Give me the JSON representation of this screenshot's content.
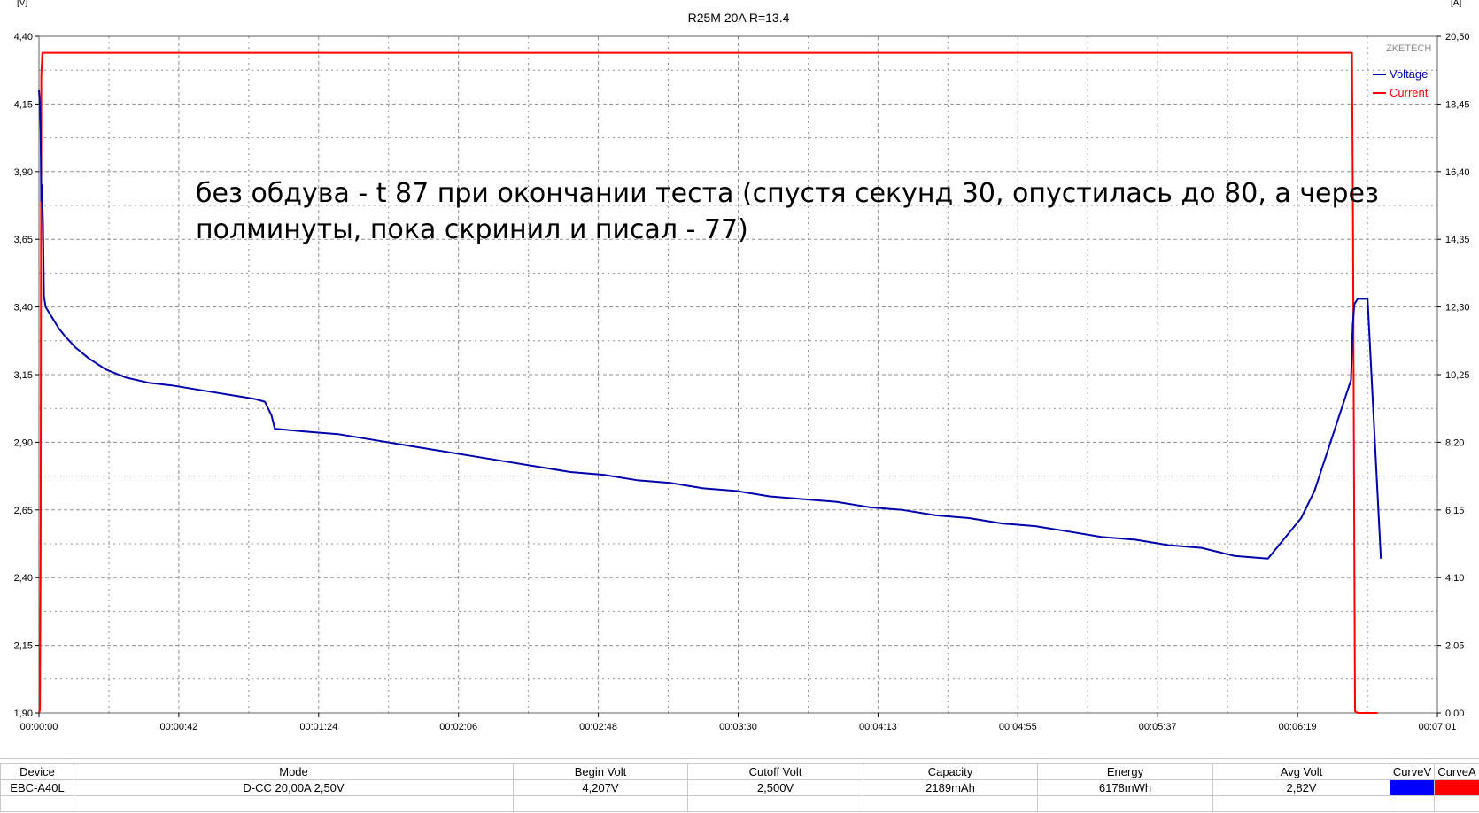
{
  "chart_data": {
    "type": "line",
    "title": "R25M 20A R=13.4",
    "y_left_unit": "[V]",
    "y_right_unit": "[A]",
    "ylim_left": [
      1.9,
      4.4
    ],
    "ylim_right": [
      0,
      20.5
    ],
    "y_left_ticks": [
      "4,40",
      "4,15",
      "3,90",
      "3,65",
      "3,40",
      "3,15",
      "2,90",
      "2,65",
      "2,40",
      "2,15",
      "1,90"
    ],
    "y_right_ticks": [
      "20,50",
      "18,45",
      "16,40",
      "14,35",
      "12,30",
      "10,25",
      "8,20",
      "6,15",
      "4,10",
      "2,05",
      "0,00"
    ],
    "x_ticks": [
      "00:00:00",
      "00:00:42",
      "00:01:24",
      "00:02:06",
      "00:02:48",
      "00:03:30",
      "00:04:13",
      "00:04:55",
      "00:05:37",
      "00:06:19",
      "00:07:01"
    ],
    "xlim_seconds": [
      0,
      421
    ],
    "grid": true,
    "legend_placement": "top-right",
    "series": [
      {
        "name": "Voltage",
        "axis": "left",
        "color": "#0000aa",
        "x": [
          0,
          0.3,
          0.5,
          0.7,
          0.9,
          1.2,
          1.5,
          2,
          4,
          6,
          8,
          11,
          15,
          20,
          26,
          33,
          40,
          50,
          60,
          65,
          68,
          70,
          71,
          80,
          90,
          100,
          110,
          120,
          130,
          140,
          150,
          160,
          170,
          180,
          190,
          200,
          210,
          220,
          230,
          240,
          250,
          260,
          270,
          280,
          290,
          300,
          310,
          320,
          330,
          340,
          350,
          360,
          370,
          380,
          384,
          395,
          395.5,
          396,
          396.5,
          397,
          400,
          404
        ],
        "y": [
          4.2,
          4.15,
          4.04,
          3.79,
          3.85,
          3.71,
          3.44,
          3.4,
          3.36,
          3.32,
          3.29,
          3.25,
          3.21,
          3.17,
          3.14,
          3.12,
          3.11,
          3.09,
          3.07,
          3.06,
          3.05,
          3.0,
          2.95,
          2.94,
          2.93,
          2.91,
          2.89,
          2.87,
          2.85,
          2.83,
          2.81,
          2.79,
          2.78,
          2.76,
          2.75,
          2.73,
          2.72,
          2.7,
          2.69,
          2.68,
          2.66,
          2.65,
          2.63,
          2.62,
          2.6,
          2.59,
          2.57,
          2.55,
          2.54,
          2.52,
          2.51,
          2.48,
          2.47,
          2.62,
          2.72,
          3.13,
          3.33,
          3.41,
          3.42,
          3.43,
          3.43,
          2.47
        ]
      },
      {
        "name": "Current",
        "axis": "right",
        "color": "#ff0000",
        "x": [
          0,
          0.3,
          0.5,
          0.7,
          1,
          395,
          395.3,
          395.6,
          396,
          396.2,
          397,
          403
        ],
        "y": [
          0,
          0.1,
          5,
          19.3,
          20,
          20,
          20,
          15,
          5,
          0.05,
          0,
          0
        ]
      }
    ]
  },
  "chart_ui": {
    "watermark": "ZKETECH",
    "annotation_line1": "без обдува - t 87 при окончании теста (спустя секунд 30, опустилась до 80, а через",
    "annotation_line2": "полминуты, пока скринил и писал - 77)"
  },
  "info_table": {
    "headers": [
      "Device",
      "Mode",
      "Begin Volt",
      "Cutoff Volt",
      "Capacity",
      "Energy",
      "Avg Volt",
      "CurveV",
      "CurveA"
    ],
    "values": [
      "EBC-A40L",
      "D-CC  20,00A  2,50V",
      "4,207V",
      "2,500V",
      "2189mAh",
      "6178mWh",
      "2,82V",
      "",
      ""
    ],
    "curve_v_color": "#0000ff",
    "curve_a_color": "#ff0000"
  }
}
